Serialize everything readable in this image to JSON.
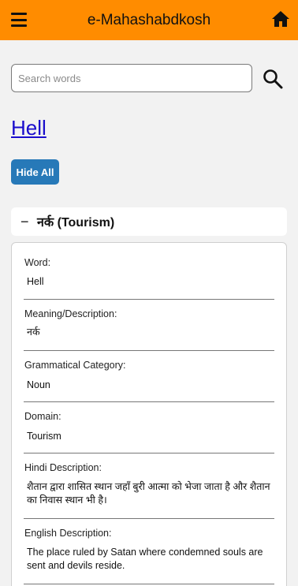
{
  "header": {
    "title": "e-Mahashabdkosh",
    "menu_icon": "hamburger-menu-icon",
    "home_icon": "home-icon",
    "background_color": "#ff8c00"
  },
  "search": {
    "placeholder": "Search words",
    "value": "",
    "icon": "search-icon"
  },
  "word": {
    "title": "Hell"
  },
  "hide_all_button": {
    "label": "Hide All",
    "color": "#2779b8"
  },
  "accordion": {
    "toggle_symbol": "−",
    "label": "नर्क (Tourism)"
  },
  "details": {
    "word_label": "Word:",
    "word_value": "Hell",
    "meaning_label": "Meaning/Description:",
    "meaning_value": "नर्क",
    "category_label": "Grammatical Category:",
    "category_value": "Noun",
    "domain_label": "Domain:",
    "domain_value": "Tourism",
    "hindi_label": "Hindi Description:",
    "hindi_value": "शैतान द्वारा शासित स्थान जहाँ बुरी आत्मा को भेजा जाता है और शैतान का निवास स्थान भी है।",
    "english_label": "English Description:",
    "english_value": "The place ruled by Satan where condemned souls are sent and devils reside."
  }
}
